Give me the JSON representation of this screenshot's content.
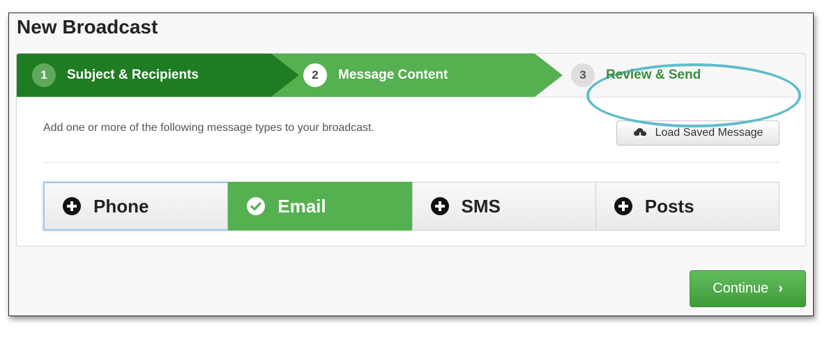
{
  "page": {
    "title": "New Broadcast"
  },
  "wizard": {
    "steps": [
      {
        "number": "1",
        "label": "Subject & Recipients",
        "state": "complete"
      },
      {
        "number": "2",
        "label": "Message Content",
        "state": "active"
      },
      {
        "number": "3",
        "label": "Review & Send",
        "state": "upcoming"
      }
    ]
  },
  "content": {
    "instructions": "Add one or more of the following message types to your broadcast.",
    "load_button_label": "Load Saved Message",
    "load_button_icon": "cloud-download-icon"
  },
  "message_types": [
    {
      "label": "Phone",
      "icon": "plus-circle-icon",
      "selected": false
    },
    {
      "label": "Email",
      "icon": "check-circle-icon",
      "selected": true
    },
    {
      "label": "SMS",
      "icon": "plus-circle-icon",
      "selected": false
    },
    {
      "label": "Posts",
      "icon": "plus-circle-icon",
      "selected": false
    }
  ],
  "footer": {
    "continue_label": "Continue",
    "continue_icon": "chevron-right-icon"
  },
  "colors": {
    "step_complete": "#1e7d22",
    "step_active": "#55b04f",
    "selected_tab": "#55b04f",
    "highlight_ring": "#5fbccb"
  }
}
